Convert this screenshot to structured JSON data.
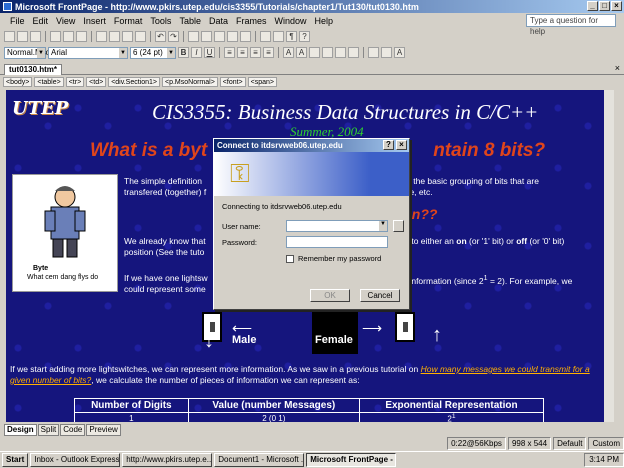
{
  "window": {
    "title": "Microsoft FrontPage - http://www.pkirs.utep.edu/cis3355/Tutorials/chapter1/Tut130/tut0130.htm"
  },
  "menu": {
    "items": [
      "File",
      "Edit",
      "View",
      "Insert",
      "Format",
      "Tools",
      "Table",
      "Data",
      "Frames",
      "Window",
      "Help"
    ],
    "help_placeholder": "Type a question for help"
  },
  "format_bar": {
    "style": "Normal.Msoh",
    "font": "Arial",
    "size": "6 (24 pt)",
    "bold": "B",
    "italic": "I",
    "underline": "U"
  },
  "document_tab": {
    "label": "tut0130.htm*"
  },
  "tags": [
    "<body>",
    "<table>",
    "<tr>",
    "<td>",
    "<div.Section1>",
    "<p.MsoNormal>",
    "<font>",
    "<span>"
  ],
  "page": {
    "course_title": "CIS3355: Business Data Structures in C/C++",
    "term": "Summer, 2004",
    "headline_left": "What is a byt",
    "headline_right": "ntain 8 bits?",
    "clip_caption_1": "Byte",
    "clip_caption_2": "What cem dang flys do",
    "p1_left": "The simple definition",
    "p1_left_2": "transfered (together) f",
    "p1_right": "lso the basic grouping of bits that are",
    "p1_right_2": "age, etc.",
    "question_right": "an??",
    "p2_left": "We already know that",
    "p2_left_2": "position (See the tuto",
    "p2_right": "es to either an",
    "p2_right_on": "on",
    "p2_right_mid": "(or '1' bit) or",
    "p2_right_off": "off",
    "p2_right_end": "(or '0' bit)",
    "p3_left": "If we have one lightsw",
    "p3_left_2": "could represent some",
    "p3_right": "of information (since 2",
    "p3_right_sup": "1",
    "p3_right_end": "= 2).  For example, we",
    "male_label": "Male",
    "female_label": "Female",
    "p4_text": "If we start adding more lightswitches, we can represent more information. As we saw in a previous tutorial on",
    "p4_link": "How many messages we could transmit for a given number of bits?",
    "p4_text_end": ", we calculate the number of pieces of information we can represent as:",
    "table_headers": [
      "Number of Digits",
      "Value (number Messages)",
      "Exponential Representation"
    ],
    "table_row_1": [
      "1",
      "2 (0     1)",
      "2"
    ],
    "table_row_1_sup": "1"
  },
  "view_tabs": [
    "Design",
    "Split",
    "Code",
    "Preview"
  ],
  "status": {
    "speed": "0:22@56Kbps",
    "size": "998 x 544",
    "style": "Default",
    "custom": "Custom"
  },
  "taskbar": {
    "start": "Start",
    "items": [
      "Inbox - Outlook Express",
      "http://www.pkirs.utep.e...",
      "Document1 - Microsoft ...",
      "Microsoft FrontPage - ..."
    ],
    "clock": "3:14 PM"
  },
  "dialog": {
    "title": "Connect to itdsrvweb06.utep.edu",
    "connecting": "Connecting to itdsrvweb06.utep.edu",
    "user_label": "User name:",
    "user_value": "",
    "password_label": "Password:",
    "remember_label": "Remember my password",
    "ok_label": "OK",
    "cancel_label": "Cancel"
  }
}
